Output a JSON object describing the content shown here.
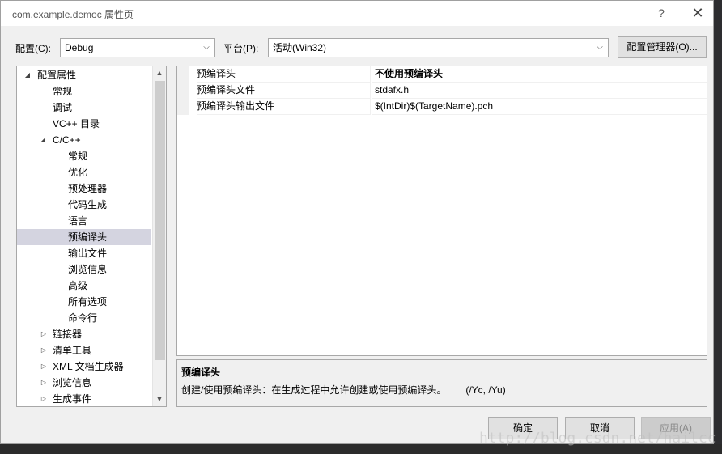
{
  "window": {
    "title": "com.example.democ 属性页",
    "help_glyph": "?",
    "close_glyph": "✕"
  },
  "toolbar": {
    "config_label": "配置(C):",
    "config_value": "Debug",
    "platform_label": "平台(P):",
    "platform_value": "活动(Win32)",
    "config_manager_label": "配置管理器(O)..."
  },
  "tree": {
    "items": [
      {
        "label": "配置属性",
        "expanded": true
      },
      {
        "label": "常规"
      },
      {
        "label": "调试"
      },
      {
        "label": "VC++ 目录"
      },
      {
        "label": "C/C++",
        "expanded": true
      },
      {
        "label": "常规"
      },
      {
        "label": "优化"
      },
      {
        "label": "预处理器"
      },
      {
        "label": "代码生成"
      },
      {
        "label": "语言"
      },
      {
        "label": "预编译头",
        "selected": true
      },
      {
        "label": "输出文件"
      },
      {
        "label": "浏览信息"
      },
      {
        "label": "高级"
      },
      {
        "label": "所有选项"
      },
      {
        "label": "命令行"
      },
      {
        "label": "链接器",
        "expanded": false
      },
      {
        "label": "清单工具",
        "expanded": false
      },
      {
        "label": "XML 文档生成器",
        "expanded": false
      },
      {
        "label": "浏览信息",
        "expanded": false
      },
      {
        "label": "生成事件",
        "expanded": false
      }
    ]
  },
  "grid": {
    "rows": [
      {
        "name": "预编译头",
        "value": "不使用预编译头",
        "bold": true
      },
      {
        "name": "预编译头文件",
        "value": "stdafx.h",
        "bold": false
      },
      {
        "name": "预编译头输出文件",
        "value": "$(IntDir)$(TargetName).pch",
        "bold": false
      }
    ]
  },
  "description": {
    "title": "预编译头",
    "text": "创建/使用预编译头：在生成过程中允许创建或使用预编译头。",
    "switches": "(/Yc, /Yu)"
  },
  "buttons": {
    "ok": "确定",
    "cancel": "取消",
    "apply": "应用(A)"
  },
  "watermark": "http://blog.csdn.net/hailcc"
}
